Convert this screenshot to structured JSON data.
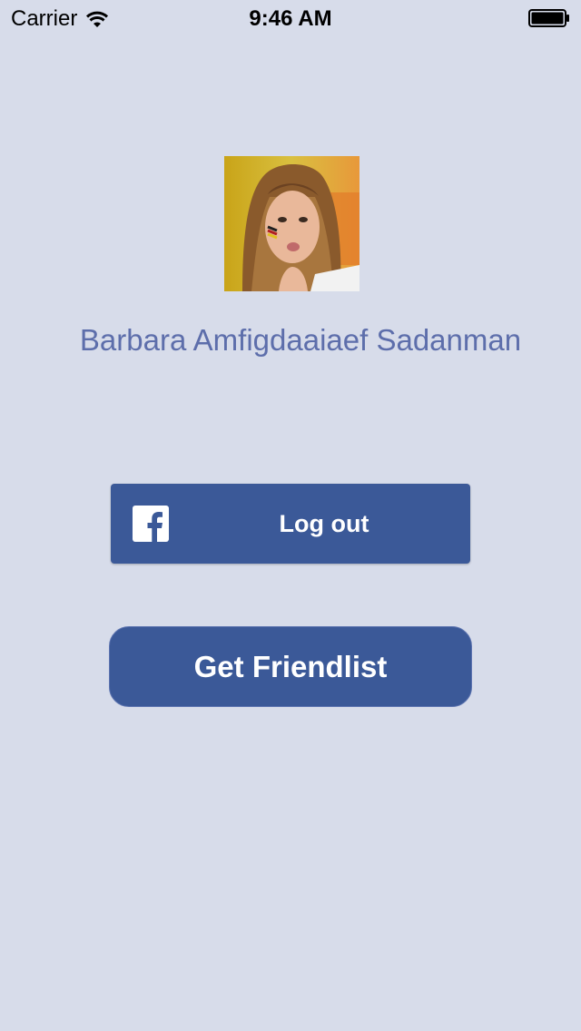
{
  "status_bar": {
    "carrier": "Carrier",
    "time": "9:46 AM",
    "wifi_icon": "wifi-icon",
    "battery_icon": "battery-icon"
  },
  "profile": {
    "avatar_icon": "profile-photo",
    "name": "Barbara Amfigdaaiaef Sadanman"
  },
  "actions": {
    "logout_label": "Log out",
    "facebook_icon": "facebook-logo-icon",
    "friendlist_label": "Get Friendlist"
  },
  "colors": {
    "background": "#d7dcea",
    "facebook_blue": "#3b5998",
    "name_text": "#5d6eab"
  }
}
